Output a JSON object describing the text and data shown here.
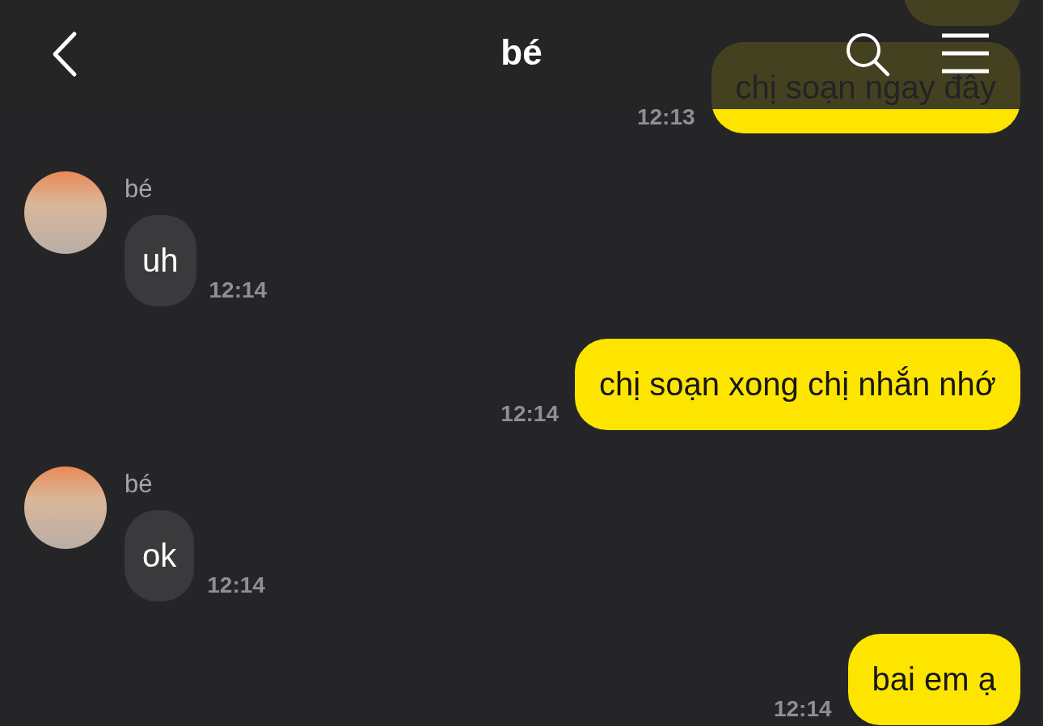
{
  "header": {
    "title": "bé"
  },
  "messages": [
    {
      "kind": "sent",
      "text": "chị soạn ngay đây",
      "time": "12:13"
    },
    {
      "kind": "received",
      "sender": "bé",
      "text": "uh",
      "time": "12:14"
    },
    {
      "kind": "sent",
      "text": "chị soạn xong chị nhắn nhớ",
      "time": "12:14"
    },
    {
      "kind": "received",
      "sender": "bé",
      "text": "ok",
      "time": "12:14"
    },
    {
      "kind": "sent",
      "text": "bai em ạ",
      "time": "12:14"
    }
  ]
}
